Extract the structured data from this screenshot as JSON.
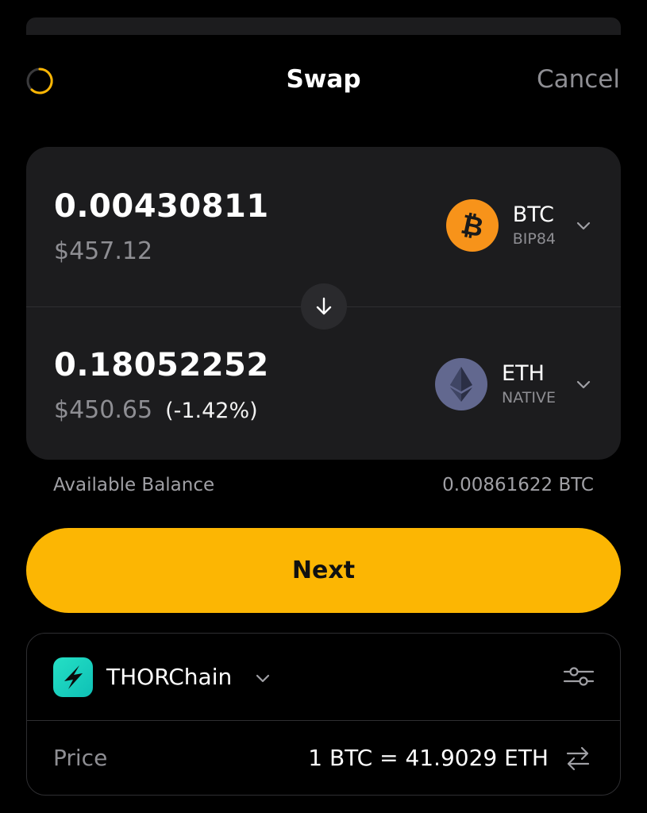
{
  "header": {
    "title": "Swap",
    "cancel_label": "Cancel"
  },
  "swap": {
    "from": {
      "amount": "0.00430811",
      "fiat": "$457.12",
      "symbol": "BTC",
      "network": "BIP84",
      "icon": "bitcoin-icon",
      "color": "#f7931a"
    },
    "to": {
      "amount": "0.18052252",
      "fiat": "$450.65",
      "change": "(-1.42%)",
      "symbol": "ETH",
      "network": "NATIVE",
      "icon": "ethereum-icon",
      "color": "#62688f"
    }
  },
  "balance": {
    "label": "Available Balance",
    "value": "0.00861622 BTC"
  },
  "next_label": "Next",
  "provider": {
    "name": "THORChain",
    "icon": "thorchain-icon"
  },
  "price": {
    "label": "Price",
    "value": "1 BTC = 41.9029 ETH"
  },
  "colors": {
    "accent": "#fcb603",
    "card": "#1c1c1e",
    "muted": "#8e8e93"
  }
}
